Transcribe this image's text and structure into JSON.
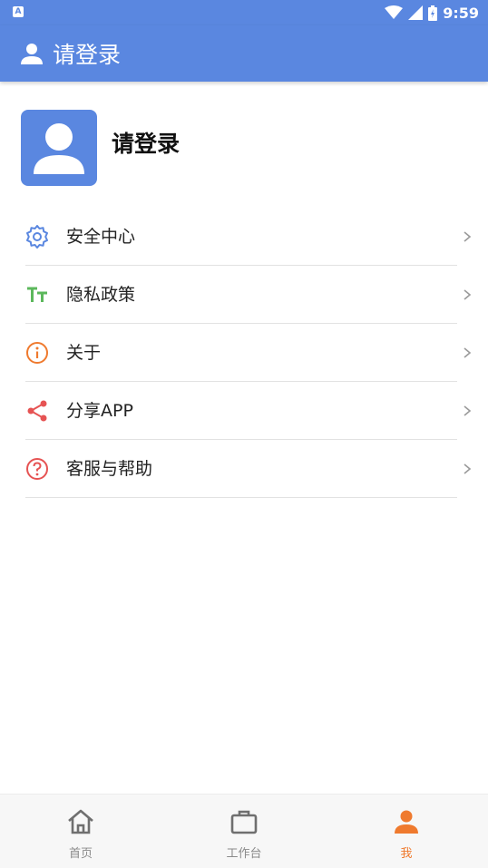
{
  "status_bar": {
    "time": "9:59",
    "left_icon": "A",
    "icons": [
      "wifi-icon",
      "signal-icon",
      "battery-icon"
    ]
  },
  "app_bar": {
    "title": "请登录",
    "icon": "user-icon"
  },
  "profile": {
    "name": "请登录",
    "avatar_icon": "avatar-placeholder-icon"
  },
  "menu": {
    "items": [
      {
        "label": "安全中心",
        "icon": "gear-icon",
        "color": "#5a87e0"
      },
      {
        "label": "隐私政策",
        "icon": "text-size-icon",
        "color": "#5cb85c"
      },
      {
        "label": "关于",
        "icon": "info-icon",
        "color": "#ef7a2e"
      },
      {
        "label": "分享APP",
        "icon": "share-icon",
        "color": "#e65353"
      },
      {
        "label": "客服与帮助",
        "icon": "help-icon",
        "color": "#e65353"
      }
    ]
  },
  "bottom_nav": {
    "tabs": [
      {
        "label": "首页",
        "icon": "home-icon",
        "active": false
      },
      {
        "label": "工作台",
        "icon": "briefcase-icon",
        "active": false
      },
      {
        "label": "我",
        "icon": "person-icon",
        "active": true
      }
    ]
  },
  "colors": {
    "primary": "#5a87e0",
    "active_tab": "#ef7a2e",
    "inactive_tab": "#8a8a8a"
  }
}
